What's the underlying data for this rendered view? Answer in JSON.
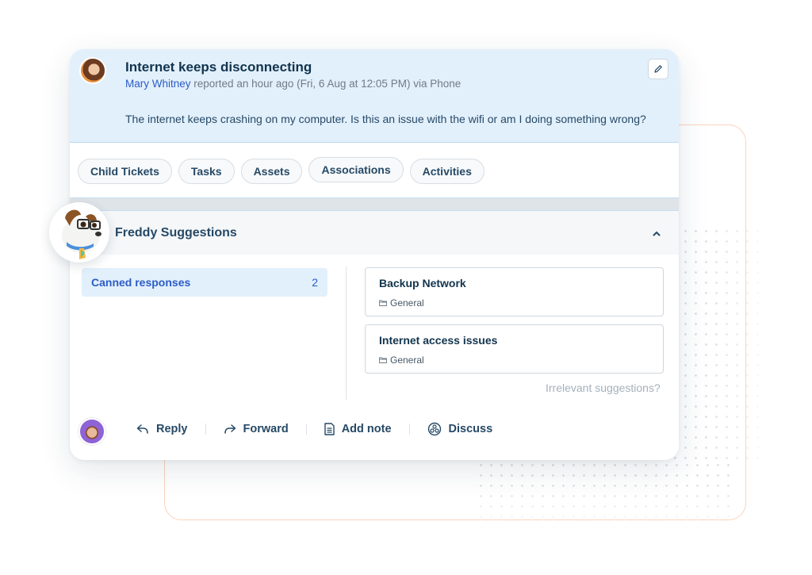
{
  "ticket": {
    "title": "Internet keeps disconnecting",
    "requester_name": "Mary Whitney",
    "meta_suffix": " reported an hour ago (Fri, 6 Aug at 12:05 PM) via Phone",
    "description": "The internet keeps crashing on my computer. Is this an issue with the wifi or am I doing something wrong?",
    "edit_icon": "pencil-icon"
  },
  "tabs": [
    {
      "label": "Child Tickets"
    },
    {
      "label": "Tasks"
    },
    {
      "label": "Assets"
    },
    {
      "label": "Associations"
    },
    {
      "label": "Activities"
    }
  ],
  "freddy": {
    "title": "Freddy Suggestions",
    "collapse_icon": "chevron-up-icon",
    "category": {
      "label": "Canned responses",
      "count": "2"
    },
    "responses": [
      {
        "title": "Backup Network",
        "folder": "General"
      },
      {
        "title": "Internet access issues",
        "folder": "General"
      }
    ],
    "irrelevant_link": "Irrelevant suggestions?"
  },
  "actions": [
    {
      "label": "Reply",
      "icon": "reply-icon"
    },
    {
      "label": "Forward",
      "icon": "forward-icon"
    },
    {
      "label": "Add note",
      "icon": "note-icon"
    },
    {
      "label": "Discuss",
      "icon": "discuss-icon"
    }
  ],
  "colors": {
    "header_bg": "#e2f0fc",
    "link_blue": "#2c5cc5",
    "text_dark": "#12344d",
    "frame_orange": "#fbd2bd"
  }
}
